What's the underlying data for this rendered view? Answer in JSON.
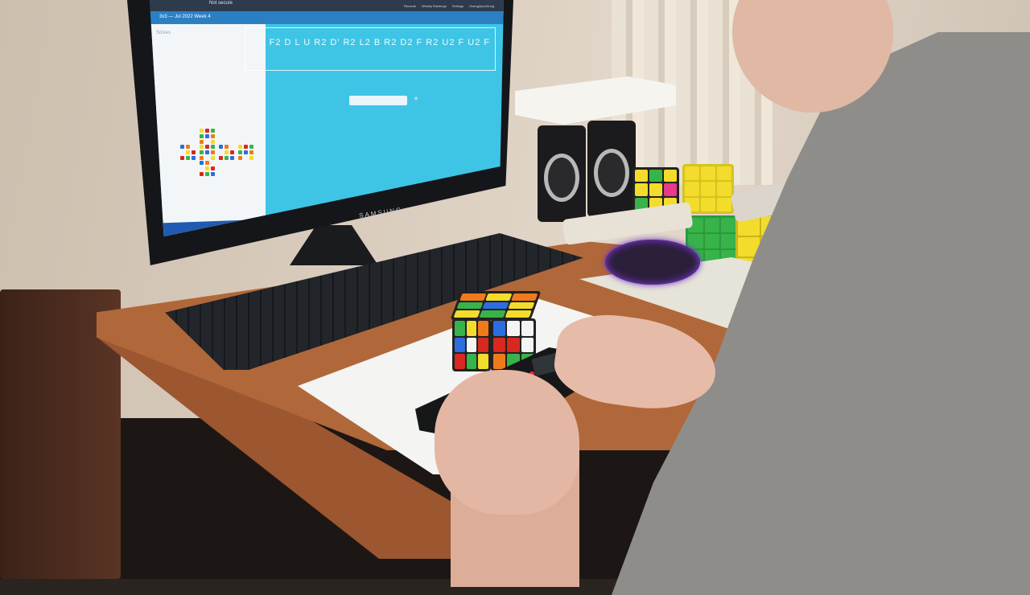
{
  "screen": {
    "window_title": "3x3 — Jul 2022 Week 4",
    "url_text": "Not secure",
    "menu": [
      "Records",
      "Weekly Rankings",
      "Settings",
      "HoangQuocDung"
    ],
    "sidebar_title": "Solves",
    "scramble": "U L F2 D L U R2 D' R2 L2 B R2 D2 F R2 U2 F U2 F"
  },
  "monitor_brand": "SAMSUNG",
  "colors": {
    "screen_bg": "#3ec5e6",
    "cube_white": "#f4f4f4",
    "cube_yellow": "#f3dc2b",
    "cube_red": "#d8281f",
    "cube_orange": "#f07a1b",
    "cube_blue": "#2c6de0",
    "cube_green": "#38b34a"
  }
}
